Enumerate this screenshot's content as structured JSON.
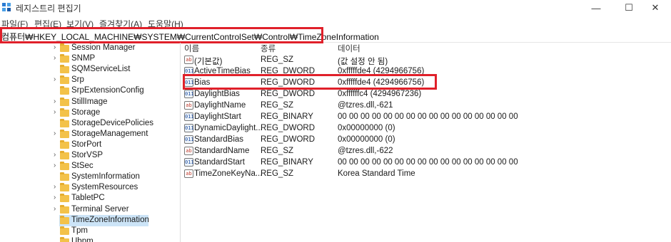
{
  "window": {
    "title": "레지스트리 편집기",
    "minimize": "—",
    "maximize": "☐",
    "close": "✕"
  },
  "menu": [
    "파일(F)",
    "편집(E)",
    "보기(V)",
    "즐겨찾기(A)",
    "도움말(H)"
  ],
  "address": "컴퓨터₩HKEY_LOCAL_MACHINE₩SYSTEM₩CurrentControlSet₩Control₩TimeZoneInformation",
  "tree": [
    {
      "label": "Session Manager",
      "chevron": "›"
    },
    {
      "label": "SNMP",
      "chevron": "›"
    },
    {
      "label": "SQMServiceList",
      "chevron": ""
    },
    {
      "label": "Srp",
      "chevron": "›"
    },
    {
      "label": "SrpExtensionConfig",
      "chevron": ""
    },
    {
      "label": "StillImage",
      "chevron": "›"
    },
    {
      "label": "Storage",
      "chevron": "›"
    },
    {
      "label": "StorageDevicePolicies",
      "chevron": ""
    },
    {
      "label": "StorageManagement",
      "chevron": "›"
    },
    {
      "label": "StorPort",
      "chevron": ""
    },
    {
      "label": "StorVSP",
      "chevron": "›"
    },
    {
      "label": "StSec",
      "chevron": "›"
    },
    {
      "label": "SystemInformation",
      "chevron": ""
    },
    {
      "label": "SystemResources",
      "chevron": "›"
    },
    {
      "label": "TabletPC",
      "chevron": "›"
    },
    {
      "label": "Terminal Server",
      "chevron": "›"
    },
    {
      "label": "TimeZoneInformation",
      "chevron": "",
      "selected": true
    },
    {
      "label": "Tpm",
      "chevron": ""
    },
    {
      "label": "Ubpm",
      "chevron": ""
    }
  ],
  "columns": {
    "name": "이름",
    "type": "종류",
    "data": "데이터"
  },
  "values": [
    {
      "icon": "string-value-icon",
      "glyph": "ab",
      "kind": "sz",
      "name": "(기본값)",
      "type": "REG_SZ",
      "data": "(값 설정 안 됨)"
    },
    {
      "icon": "binary-value-icon",
      "glyph": "011",
      "kind": "bin",
      "name": "ActiveTimeBias",
      "type": "REG_DWORD",
      "data": "0xfffffde4 (4294966756)"
    },
    {
      "icon": "binary-value-icon",
      "glyph": "011",
      "kind": "bin",
      "name": "Bias",
      "type": "REG_DWORD",
      "data": "0xfffffde4 (4294966756)"
    },
    {
      "icon": "binary-value-icon",
      "glyph": "011",
      "kind": "bin",
      "name": "DaylightBias",
      "type": "REG_DWORD",
      "data": "0xffffffc4 (4294967236)"
    },
    {
      "icon": "string-value-icon",
      "glyph": "ab",
      "kind": "sz",
      "name": "DaylightName",
      "type": "REG_SZ",
      "data": "@tzres.dll,-621"
    },
    {
      "icon": "binary-value-icon",
      "glyph": "011",
      "kind": "bin",
      "name": "DaylightStart",
      "type": "REG_BINARY",
      "data": "00 00 00 00 00 00 00 00 00 00 00 00 00 00 00 00"
    },
    {
      "icon": "binary-value-icon",
      "glyph": "011",
      "kind": "bin",
      "name": "DynamicDaylight...",
      "type": "REG_DWORD",
      "data": "0x00000000 (0)"
    },
    {
      "icon": "binary-value-icon",
      "glyph": "011",
      "kind": "bin",
      "name": "StandardBias",
      "type": "REG_DWORD",
      "data": "0x00000000 (0)"
    },
    {
      "icon": "string-value-icon",
      "glyph": "ab",
      "kind": "sz",
      "name": "StandardName",
      "type": "REG_SZ",
      "data": "@tzres.dll,-622"
    },
    {
      "icon": "binary-value-icon",
      "glyph": "011",
      "kind": "bin",
      "name": "StandardStart",
      "type": "REG_BINARY",
      "data": "00 00 00 00 00 00 00 00 00 00 00 00 00 00 00 00"
    },
    {
      "icon": "string-value-icon",
      "glyph": "ab",
      "kind": "sz",
      "name": "TimeZoneKeyNa...",
      "type": "REG_SZ",
      "data": "Korea Standard Time"
    }
  ],
  "colors": {
    "highlight": "#e0202a",
    "selection": "#cce4f7",
    "folder": "#f3c249"
  }
}
